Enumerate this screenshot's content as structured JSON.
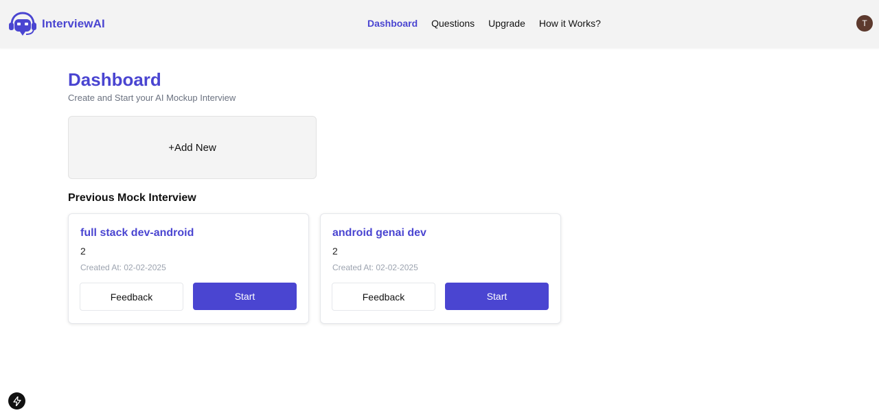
{
  "header": {
    "brand": "InterviewAI",
    "nav": [
      {
        "label": "Dashboard",
        "active": true
      },
      {
        "label": "Questions",
        "active": false
      },
      {
        "label": "Upgrade",
        "active": false
      },
      {
        "label": "How it Works?",
        "active": false
      }
    ],
    "avatar_initial": "T",
    "icons": {
      "logo": "robot-headset-icon"
    }
  },
  "main": {
    "title": "Dashboard",
    "subtitle": "Create and Start your AI Mockup Interview",
    "add_new_label": "+Add New",
    "section_title": "Previous Mock Interview",
    "interviews": [
      {
        "title": "full stack dev-android",
        "count": "2",
        "created": "Created At: 02-02-2025",
        "feedback_label": "Feedback",
        "start_label": "Start"
      },
      {
        "title": "android genai dev",
        "count": "2",
        "created": "Created At: 02-02-2025",
        "feedback_label": "Feedback",
        "start_label": "Start"
      }
    ]
  },
  "footer": {
    "dev_badge_icon": "bolt-icon"
  },
  "colors": {
    "accent": "#4a45d1",
    "header_bg": "#f3f3f3",
    "avatar_bg": "#5d3a2e"
  }
}
